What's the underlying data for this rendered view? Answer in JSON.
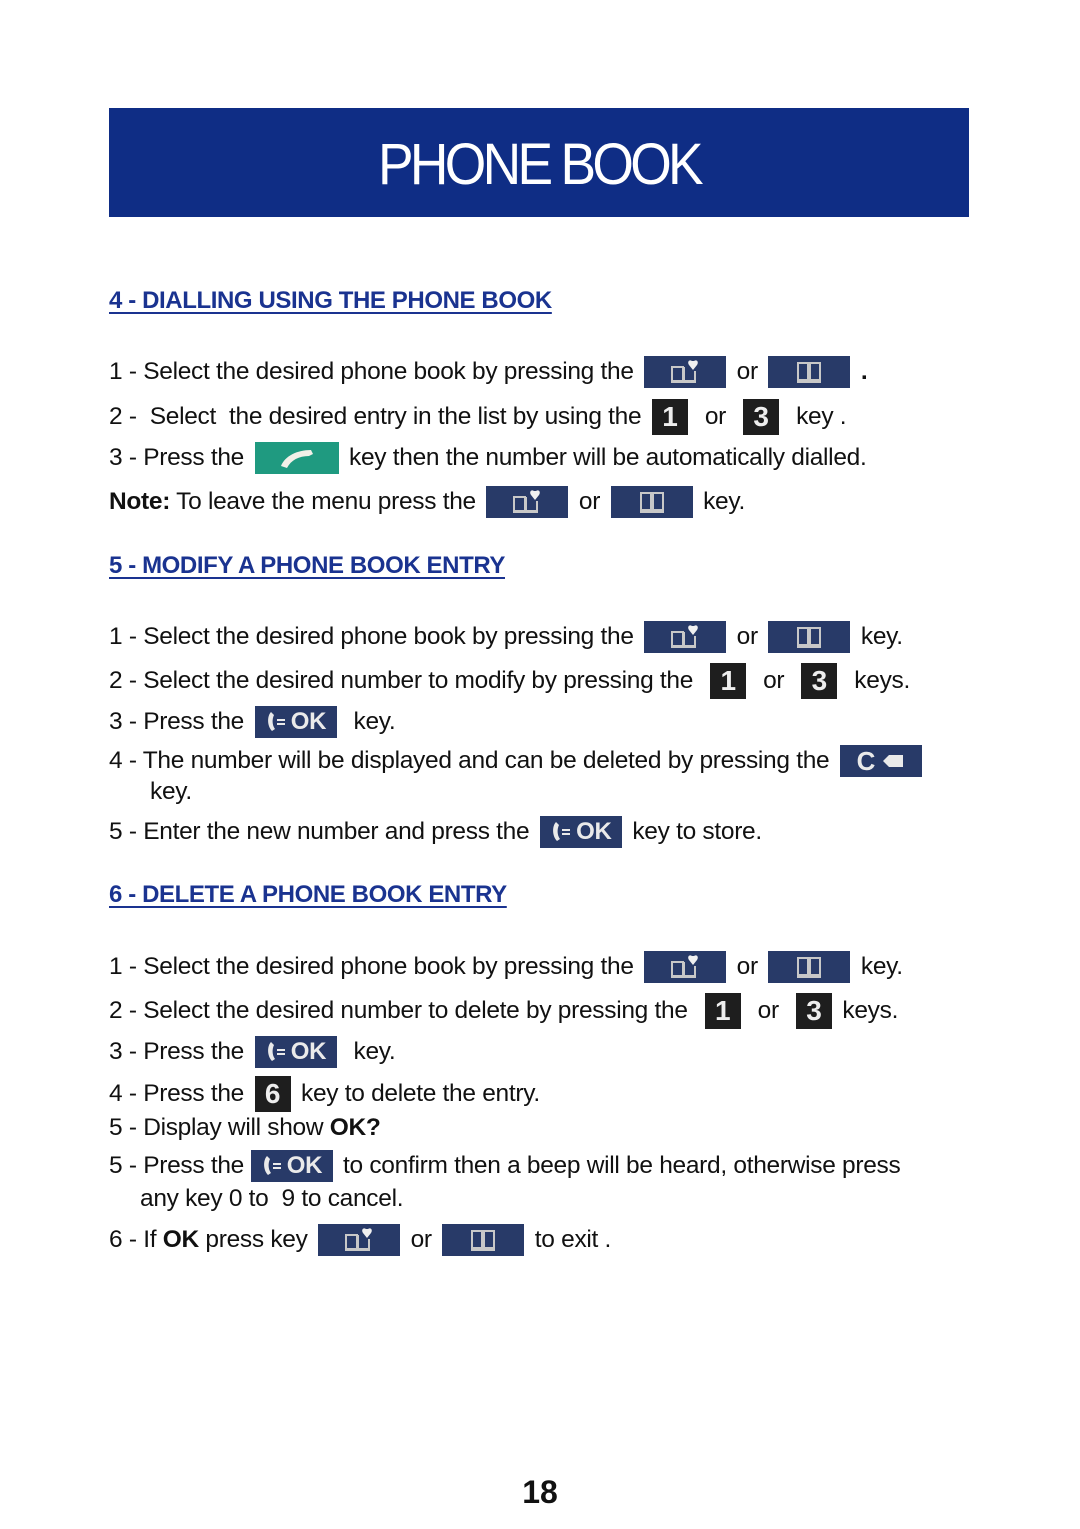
{
  "banner": {
    "title": "PHONE BOOK"
  },
  "colors": {
    "banner_bg": "#0f2d85",
    "heading": "#1a3390",
    "book_key_bg": "#283a68",
    "number_key_bg": "#1e1e1e",
    "call_key_bg": "#1f9a80"
  },
  "keys": {
    "num1": "1",
    "num3": "3",
    "num6": "6",
    "ok": "OK",
    "c": "C"
  },
  "sections": [
    {
      "heading": "4 - DIALLING USING THE PHONE BOOK",
      "steps": [
        {
          "before": "1 - Select the desired phone book by pressing the ",
          "mid": " or ",
          "after": " ."
        },
        {
          "before": "2 -  Select  the desired entry in the list by using the ",
          "mid": "  or  ",
          "after": "  key ."
        },
        {
          "before": "3 - Press the ",
          "after": " key then the number will be automatically dialled."
        }
      ],
      "note": {
        "label": "Note:",
        "before": " To leave the menu press the ",
        "mid": " or ",
        "after": " key."
      }
    },
    {
      "heading": "5 - MODIFY  A  PHONE BOOK ENTRY",
      "steps": [
        {
          "before": "1 - Select the desired phone book by pressing the ",
          "mid": " or ",
          "after": " key."
        },
        {
          "before": "2 - Select the desired number to modify by pressing the  ",
          "mid": "  or  ",
          "after": "  keys."
        },
        {
          "before": "3 - Press the ",
          "after": "  key."
        },
        {
          "before": "4 - The number will be displayed and can be deleted by pressing the ",
          "cont": "key."
        },
        {
          "before": "5 - Enter the new number and press the ",
          "after": " key to store."
        }
      ]
    },
    {
      "heading": "6 - DELETE  A PHONE BOOK ENTRY",
      "steps": [
        {
          "before": "1 - Select the desired phone book by pressing the ",
          "mid": " or ",
          "after": " key."
        },
        {
          "before": "2 - Select the desired number to delete by pressing the  ",
          "mid": "  or  ",
          "after": " keys."
        },
        {
          "before": "3 - Press the ",
          "after": "  key."
        },
        {
          "before": "4 - Press the ",
          "after": " key to delete the entry."
        },
        {
          "before": "5 - Display will show ",
          "bold": "OK?"
        },
        {
          "before": "5 - Press the ",
          "after": " to confirm then a beep will be heard, otherwise press",
          "cont": "any key 0 to  9 to cancel."
        },
        {
          "before": "6 - If ",
          "bold": "OK",
          "before2": " press key ",
          "mid": " or ",
          "after": " to exit ."
        }
      ]
    }
  ],
  "page_number": "18"
}
